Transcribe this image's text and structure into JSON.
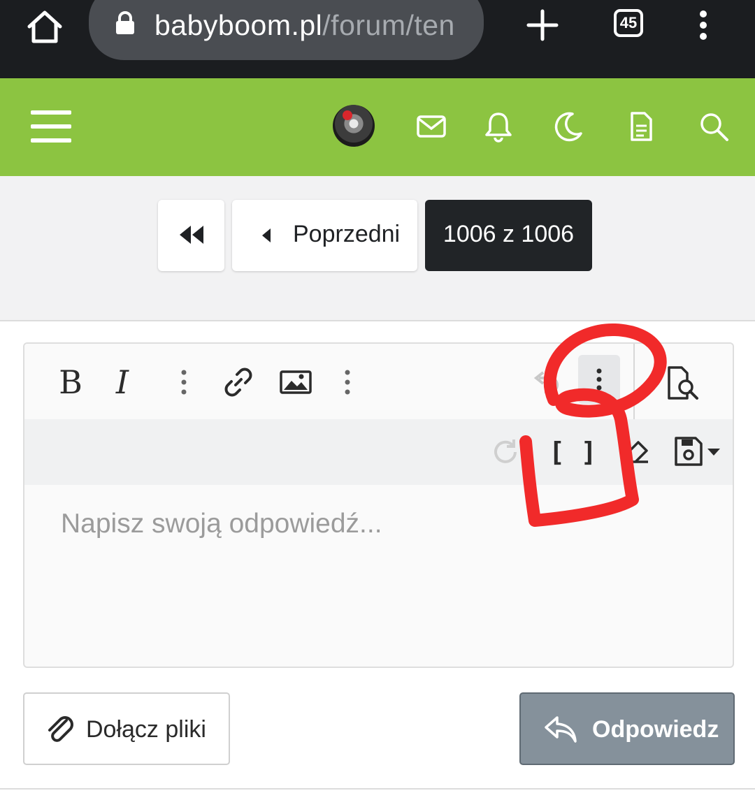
{
  "browser": {
    "url_host": "babyboom.pl",
    "url_path": "/forum/ten",
    "tab_count": "45",
    "icons": [
      "home-icon",
      "lock-icon",
      "new-tab-icon",
      "tabs-icon",
      "menu-icon"
    ]
  },
  "site_header": {
    "accent_color": "#8cc441",
    "icons": [
      "hamburger-icon",
      "avatar",
      "mail-icon",
      "bell-icon",
      "moon-icon",
      "document-icon",
      "search-icon"
    ]
  },
  "pagination": {
    "prev_label": "Poprzedni",
    "current_label": "1006 z 1006"
  },
  "editor": {
    "toolbar_row1": [
      "bold",
      "italic",
      "more-vertical",
      "link",
      "image",
      "more-vertical",
      "undo",
      "more-vertical",
      "preview"
    ],
    "toolbar_row2": [
      "redo",
      "brackets",
      "eraser",
      "save"
    ],
    "bold_glyph": "B",
    "italic_glyph": "I",
    "brackets_glyph": "[ ]",
    "placeholder": "Napisz swoją odpowiedź..."
  },
  "actions": {
    "attach_label": "Dołącz pliki",
    "reply_label": "Odpowiedz",
    "reply_color": "#85919b"
  },
  "annotation": {
    "color": "#f12a2a"
  }
}
